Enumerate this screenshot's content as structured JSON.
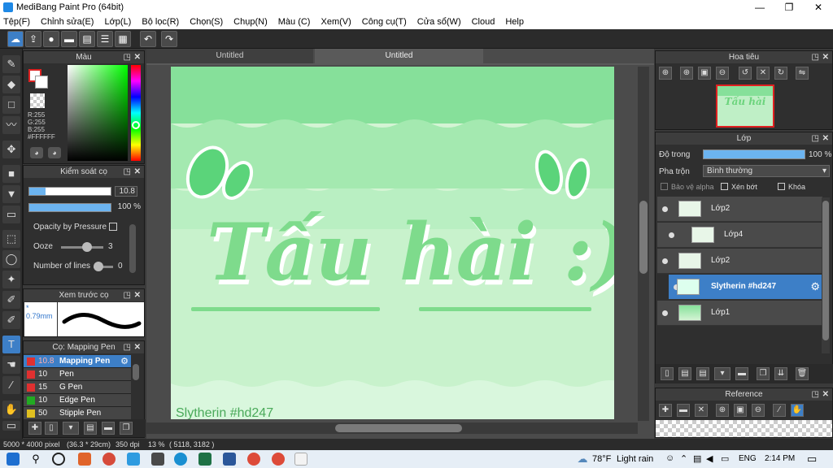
{
  "window": {
    "title": "MediBang Paint Pro (64bit)",
    "min": "—",
    "max": "❐",
    "close": "✕"
  },
  "menu": [
    "Tệp(F)",
    "Chỉnh sửa(E)",
    "Lớp(L)",
    "Bộ lọc(R)",
    "Chọn(S)",
    "Chụp(N)",
    "Màu (C)",
    "Xem(V)",
    "Công cụ(T)",
    "Cửa sổ(W)",
    "Cloud",
    "Help"
  ],
  "color_panel": {
    "title": "Màu",
    "r": "R:255",
    "g": "G:255",
    "b": "B:255",
    "hex": "#FFFFFF"
  },
  "brush_control": {
    "title": "Kiểm soát cọ",
    "size": "10.8",
    "opacity": "100 %",
    "opacity_label": "Opacity by Pressure",
    "ooze_label": "Ooze",
    "ooze_value": "3",
    "lines_label": "Number of lines",
    "lines_value": "0"
  },
  "brush_preview": {
    "title": "Xem trước cọ",
    "size": "* 0.79mm"
  },
  "brush_list": {
    "title": "Cọ: Mapping Pen",
    "items": [
      {
        "size": "10.8",
        "name": "Mapping Pen",
        "color": "#e03030",
        "selected": true
      },
      {
        "size": "10",
        "name": "Pen",
        "color": "#e03030",
        "selected": false
      },
      {
        "size": "15",
        "name": "G Pen",
        "color": "#e03030",
        "selected": false
      },
      {
        "size": "10",
        "name": "Edge Pen",
        "color": "#22aa22",
        "selected": false
      },
      {
        "size": "50",
        "name": "Stipple Pen",
        "color": "#e0c020",
        "selected": false
      }
    ]
  },
  "canvas": {
    "tab1": "Untitled",
    "tab2": "Untitled",
    "title_text": "Tấu hài :))",
    "signature": "Slytherin #hd247"
  },
  "navigator": {
    "title": "Hoa tiêu",
    "thumb_text": "Tấu hài"
  },
  "layers": {
    "title": "Lớp",
    "opacity_label": "Độ trong",
    "opacity_value": "100 %",
    "blend_label": "Pha trộn",
    "blend_value": "Bình thường",
    "protect_alpha": "Bảo vệ alpha",
    "clip": "Xén bớt",
    "lock": "Khóa",
    "items": [
      {
        "name": "Lớp2",
        "selected": false,
        "indent": false
      },
      {
        "name": "Lớp4",
        "selected": false,
        "indent": true
      },
      {
        "name": "Lớp2",
        "selected": false,
        "indent": false
      },
      {
        "name": "Slytherin #hd247",
        "selected": true,
        "indent": false
      },
      {
        "name": "Lớp1",
        "selected": false,
        "indent": false
      }
    ]
  },
  "reference": {
    "title": "Reference"
  },
  "status": {
    "size": "5000 * 4000 pixel",
    "cm": "(36.3 * 29cm)",
    "dpi": "350 dpi",
    "zoom": "13 %",
    "coords": "( 5118, 3182 )"
  },
  "taskbar": {
    "weather_temp": "78°F",
    "weather_text": "Light rain",
    "lang": "ENG",
    "time": "2:14 PM"
  }
}
